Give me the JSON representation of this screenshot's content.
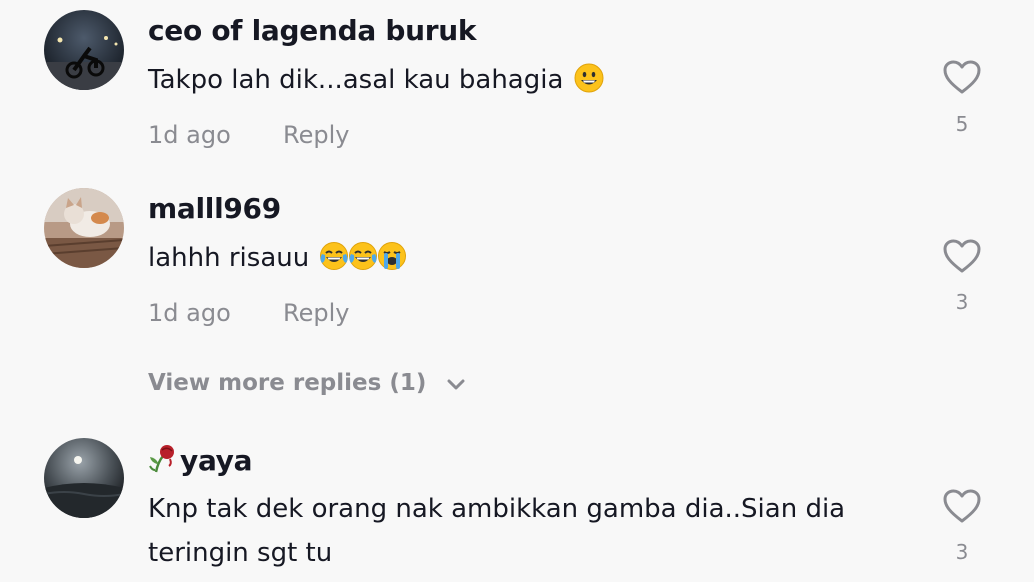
{
  "comments": [
    {
      "username": "ceo of lagenda buruk",
      "text": "Takpo lah dik...asal kau bahagia",
      "emoji": "grinning-face",
      "time": "1d ago",
      "reply_label": "Reply",
      "likes": "5"
    },
    {
      "username": "malll969",
      "text": "lahhh risauu",
      "emoji": "laughing-crying-face x2, loudly-crying-face",
      "time": "1d ago",
      "reply_label": "Reply",
      "likes": "3"
    },
    {
      "username": "yaya",
      "username_prefix_icon": "wilted-rose-icon",
      "text_line1": "Knp tak dek orang nak ambikkan gamba dia..Sian dia",
      "text_line2": "teringin sgt tu",
      "likes": "3"
    }
  ],
  "view_more_replies": "View more replies (1)",
  "colors": {
    "background": "#f8f8f8",
    "primary_text": "#161823",
    "secondary_text": "#8a8b91"
  }
}
